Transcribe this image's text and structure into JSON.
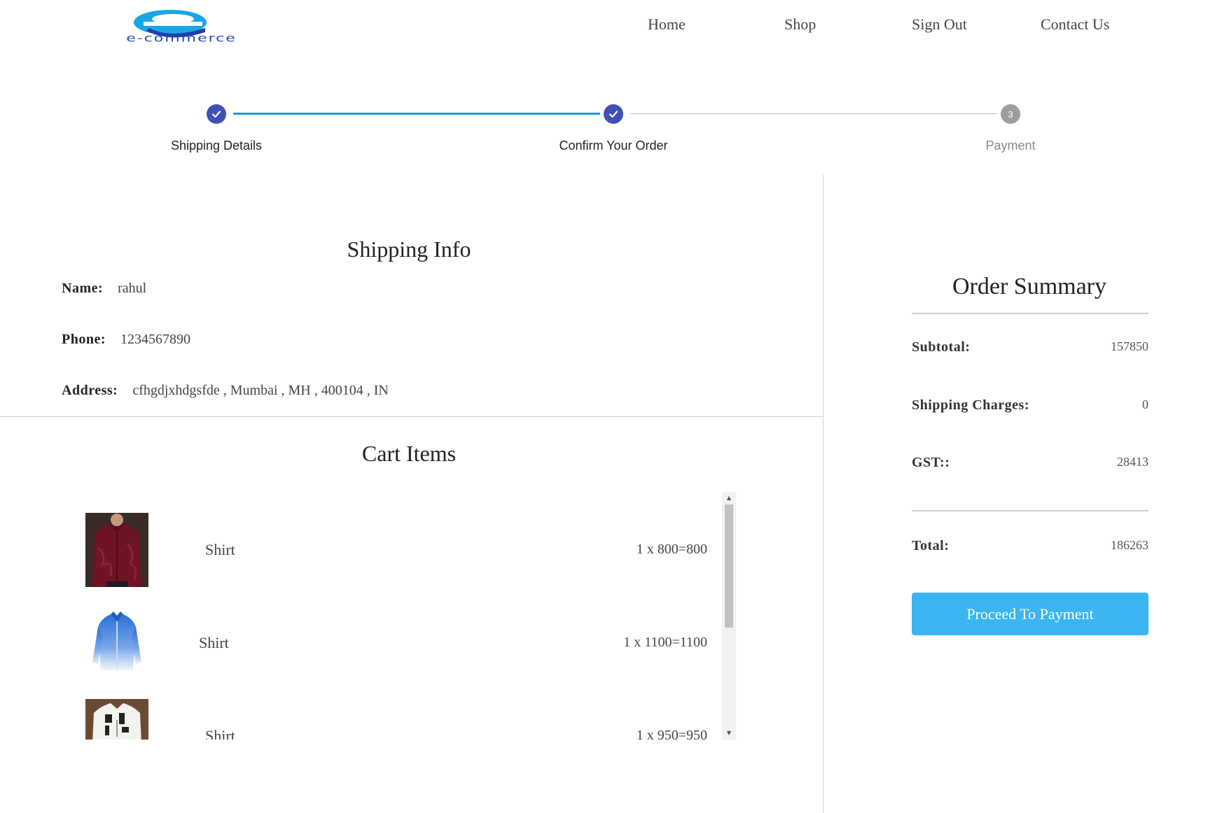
{
  "header": {
    "logo_text": "e-commerce",
    "nav": [
      {
        "label": "Home"
      },
      {
        "label": "Shop"
      },
      {
        "label": "Sign Out"
      },
      {
        "label": "Contact Us"
      }
    ]
  },
  "stepper": {
    "steps": [
      {
        "label": "Shipping Details",
        "state": "completed"
      },
      {
        "label": "Confirm Your Order",
        "state": "completed"
      },
      {
        "label": "Payment",
        "number": "3",
        "state": "pending"
      }
    ],
    "colors": {
      "completed": "#3f51b5",
      "active_line": "#1a9ae0",
      "pending": "#9e9e9e"
    }
  },
  "shipping": {
    "title": "Shipping Info",
    "name_label": "Name:",
    "name": "rahul",
    "phone_label": "Phone:",
    "phone": "1234567890",
    "address_label": "Address:",
    "address": "cfhgdjxhdgsfde , Mumbai , MH , 400104 , IN"
  },
  "cart": {
    "title": "Cart Items",
    "items": [
      {
        "name": "Shirt",
        "price_text": "1 x 800=800",
        "image": "maroon-shirt"
      },
      {
        "name": "Shirt",
        "price_text": "1 x 1100=1100",
        "image": "blue-gradient-shirt"
      },
      {
        "name": "Shirt",
        "price_text": "1 x 950=950",
        "image": "white-printed-shirt"
      }
    ]
  },
  "summary": {
    "title": "Order Summary",
    "subtotal_label": "Subtotal:",
    "subtotal": "157850",
    "shipping_label": "Shipping Charges:",
    "shipping": "0",
    "gst_label": "GST::",
    "gst": "28413",
    "total_label": "Total:",
    "total": "186263",
    "button_label": "Proceed To Payment",
    "button_color": "#3ab5f0"
  }
}
